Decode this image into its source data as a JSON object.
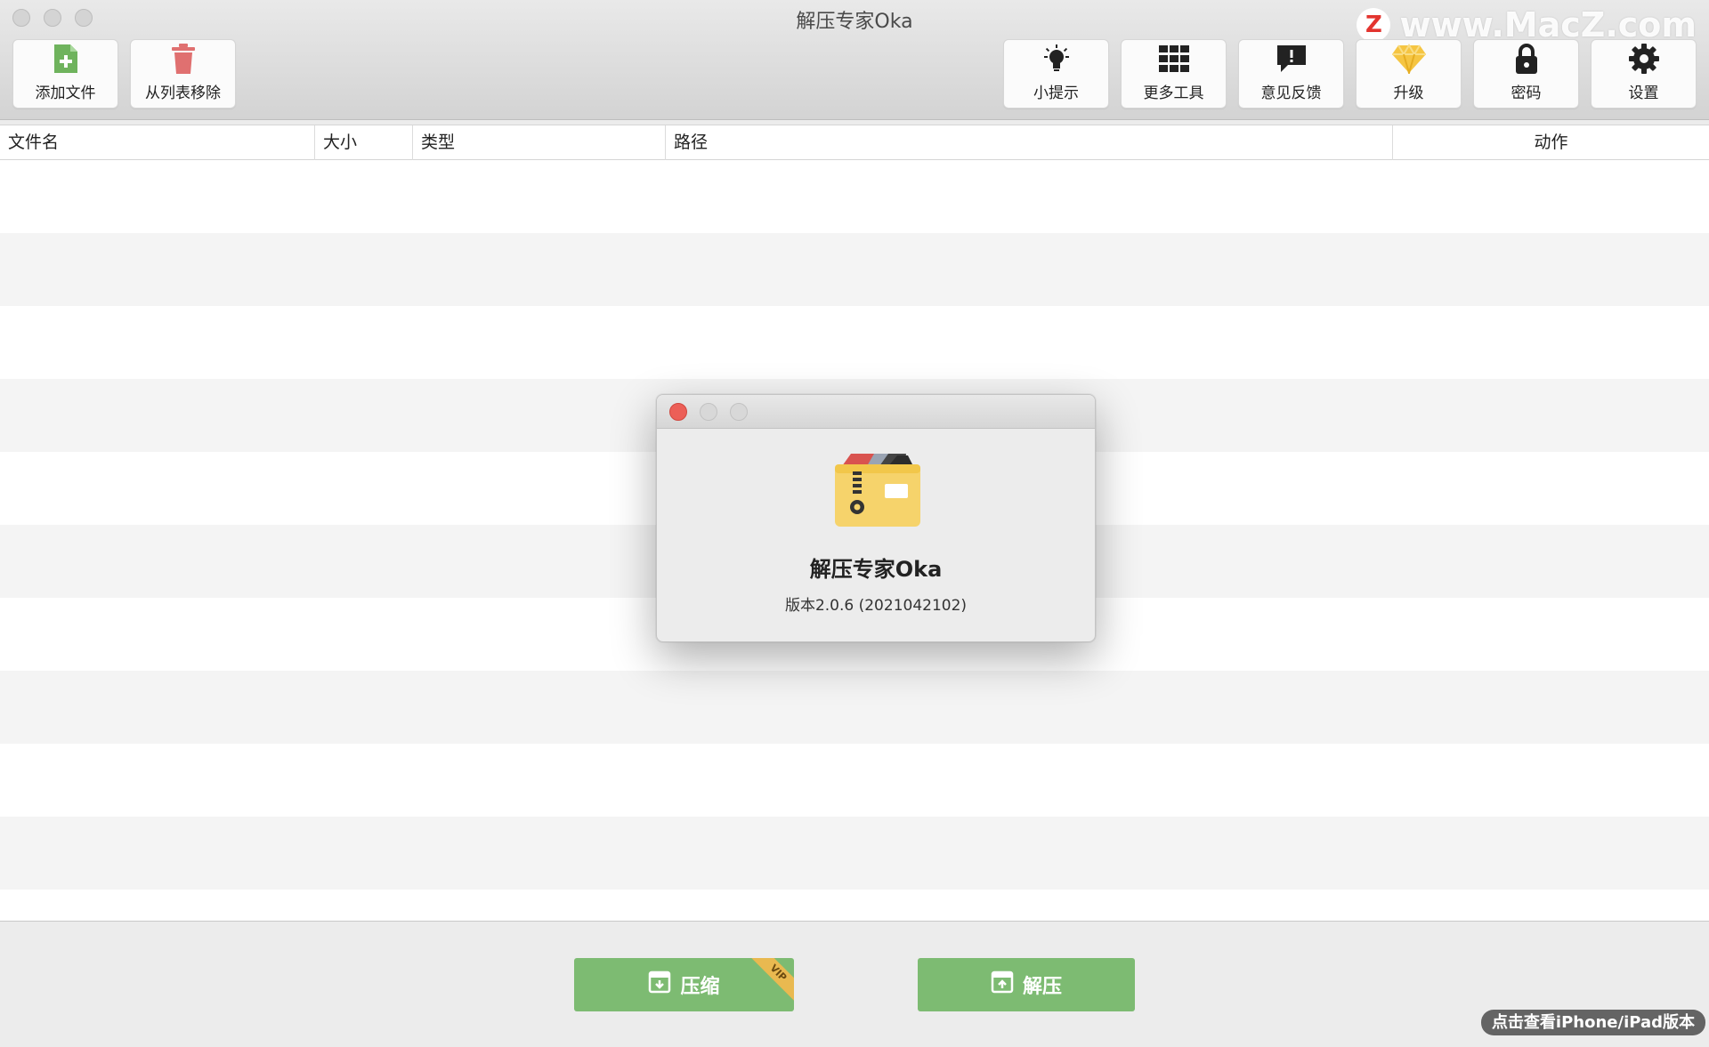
{
  "window": {
    "title": "解压专家Oka",
    "watermark_letter": "Z",
    "watermark_text": "www.MacZ.com"
  },
  "toolbar": {
    "left": [
      {
        "label": "添加文件",
        "icon": "add-file-icon"
      },
      {
        "label": "从列表移除",
        "icon": "trash-icon"
      }
    ],
    "right": [
      {
        "label": "小提示",
        "icon": "lightbulb-icon"
      },
      {
        "label": "更多工具",
        "icon": "grid-icon"
      },
      {
        "label": "意见反馈",
        "icon": "feedback-icon"
      },
      {
        "label": "升级",
        "icon": "diamond-icon"
      },
      {
        "label": "密码",
        "icon": "lock-icon"
      },
      {
        "label": "设置",
        "icon": "gear-icon"
      }
    ]
  },
  "table": {
    "columns": [
      "文件名",
      "大小",
      "类型",
      "路径",
      "动作"
    ],
    "rows": []
  },
  "actions": {
    "compress": "压缩",
    "compress_badge": "VIP",
    "extract": "解压"
  },
  "iphone_link": "点击查看iPhone/iPad版本",
  "about": {
    "app_name": "解压专家Oka",
    "version": "版本2.0.6 (2021042102)"
  },
  "colors": {
    "accent_green": "#7dbb72",
    "add_icon_green": "#6fb35d",
    "trash_red": "#e07070",
    "diamond_yellow": "#f5c542",
    "close_red": "#ec5f57"
  }
}
